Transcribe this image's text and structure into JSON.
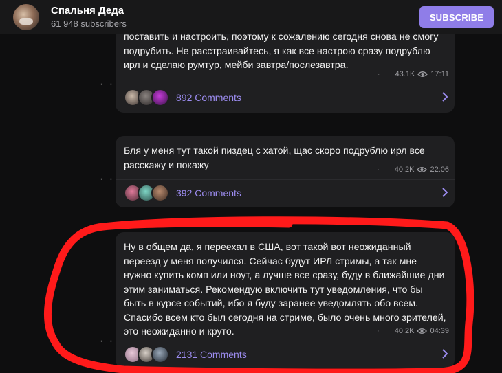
{
  "header": {
    "channel_name": "Спальня Деда",
    "subscribers": "61 948 subscribers",
    "subscribe_label": "SUBSCRIBE"
  },
  "messages": [
    {
      "text": "поставить и настроить, поэтому к сожалению сегодня снова не смогу подрубить. Не расстраивайтесь, я как все настрою сразу подрублю ирл и сделаю румтур, мейби завтра/послезавтра.",
      "views": "43.1K",
      "time": "17:11",
      "comments": "892 Comments"
    },
    {
      "text": "Бля у меня тут такой пиздец с хатой, щас скоро подрублю ирл все расскажу и покажу",
      "views": "40.2K",
      "time": "22:06",
      "comments": "392 Comments"
    },
    {
      "text": "Ну в общем да, я переехал в США, вот такой вот неожиданный переезд у меня получился. Сейчас будут ИРЛ стримы, а так мне нужно купить комп или ноут, а лучше все сразу, буду в ближайшие дни этим заниматься. Рекомендую включить тут уведомления, что бы быть в курсе событий, ибо я буду заранее уведомлять обо всем. Спасибо всем кто был сегодня на стриме, было очень много зрителей, это неожиданно и круто.",
      "views": "40.2K",
      "time": "04:39",
      "comments": "2131 Comments"
    }
  ],
  "colors": {
    "accent": "#8f7de8",
    "comments_link": "#9c8cf0",
    "highlight": "#ff1a1a",
    "bubble": "#1f1f21"
  }
}
